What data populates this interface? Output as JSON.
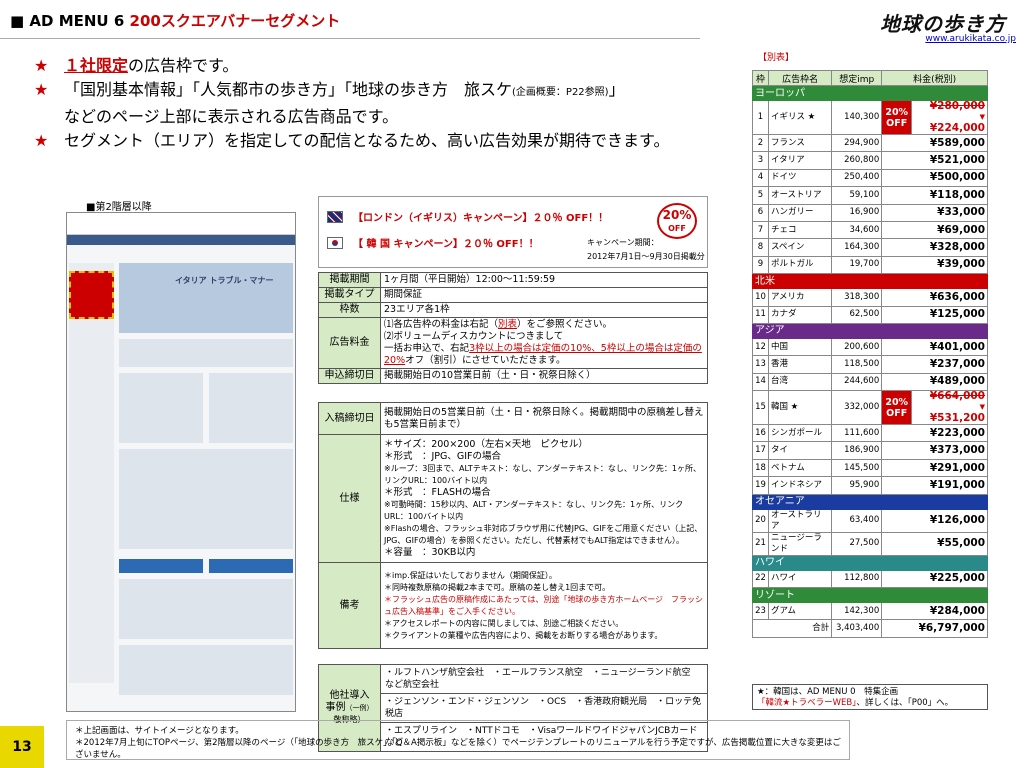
{
  "header": {
    "marker": "■",
    "menu_title": "AD MENU 6",
    "menu_subtitle": "200スクエアバナーセグメント",
    "logo_text": "地球の歩き方",
    "site_url": "www.arukikata.co.jp"
  },
  "bullets": {
    "star": "★",
    "line1_red": "１社限定",
    "line1_rest": "の広告枠です。",
    "line2_a": "「国別基本情報」「人気都市の歩き方」「地球の歩き方　旅スケ",
    "line2_ref": "(企画概要：P22参照)",
    "line2_b": "」",
    "line2_c": "などのページ上部に表示される広告商品です。",
    "line3": "セグメント（エリア）を指定しての配信となるため、高い広告効果が期待できます。"
  },
  "mockup": {
    "caption": "■第2階層以降",
    "hero_text": "イタリア トラブル・マナー"
  },
  "campaign": {
    "uk": "【ロンドン（イギリス）キャンペーン】２０％ OFF！！",
    "kr": "【 韓 国 キャンペーン】２０％ OFF！！",
    "period_label": "キャンペーン期間：",
    "period_value": "2012年7月1日～9月30日掲載分",
    "badge_pct": "20%",
    "badge_off": "OFF"
  },
  "spec": {
    "period_label": "掲載期間",
    "period_value": "1ヶ月間（平日開始）12:00～11:59:59",
    "type_label": "掲載タイプ",
    "type_value": "期間保証",
    "slots_label": "枠数",
    "slots_value": "23エリア各1枠",
    "fee_label": "広告料金",
    "fee_1a": "⑴各広告枠の料金は右記（",
    "fee_1b": "別表",
    "fee_1c": "）をご参照ください。",
    "fee_2": "⑵ボリュームディスカウントにつきまして",
    "fee_3a": "一括お申込で、右記",
    "fee_3b": "3枠以上の場合は定価の10%、5枠以上の場合は定価の20%",
    "fee_3c": "オフ（割引）にさせていただきます。",
    "deadline_label": "申込締切日",
    "deadline_value": "掲載開始日の10営業日前（土・日・祝祭日除く）",
    "submit_label": "入稿締切日",
    "submit_value": "掲載開始日の5営業日前（土・日・祝祭日除く。掲載期間中の原稿差し替えも5営業日前まで）",
    "spec_label": "仕様",
    "spec_size": "＊サイズ：200×200（左右×天地　ピクセル）",
    "spec_jpg": "＊形式　：JPG、GIFの場合",
    "spec_jpg_note": "※ループ：3回まで、ALTテキスト：なし、アンダーテキスト：なし、リンク先：1ヶ所、リンクURL：100バイト以内",
    "spec_flash": "＊形式　：FLASHの場合",
    "spec_flash_note": "※可動時間：15秒以内、ALT・アンダーテキスト：なし、リンク先：1ヶ所、リンクURL：100バイト以内",
    "spec_flash_note2": "※Flashの場合、フラッシュ非対応ブラウザ用に代替JPG、GIFをご用意ください（上記、JPG、GIFの場合）を参照ください。ただし、代替素材でもALT指定はできません）。",
    "spec_cap": "＊容量　：30KB以内",
    "remarks_label": "備考",
    "rem1": "＊imp.保証はいたしておりません（期間保証）。",
    "rem2": "＊同時複数原稿の掲載2本まで可。原稿の差し替え1回まで可。",
    "rem3": "＊フラッシュ広告の原稿作成にあたっては、別途「地球の歩き方ホームページ　フラッシュ広告入稿基準」をご入手ください。",
    "rem4": "＊アクセスレポートの内容に関しましては、別途ご相談ください。",
    "rem5": "＊クライアントの業種や広告内容により、掲載をお断りする場合があります。"
  },
  "partners": {
    "label1": "他社導入",
    "label2": "事例",
    "label2b": "（一例）",
    "label3": "敬称略）",
    "row1": "・ルフトハンザ航空会社　・エールフランス航空　・ニュージーランド航空　など航空会社",
    "row2": "・ジェンソン・エンド・ジェンソン　・OCS　・香港政府観光局　・ロッテ免税店",
    "row3": "・エスプリライン　・NTTドコモ　・VisaワールドワイドジャパンJCBカード　など"
  },
  "price_table": {
    "caption": "【別表】",
    "headers": [
      "枠",
      "広告枠名",
      "想定imp",
      "料金(税別)"
    ],
    "regions": {
      "europe": "ヨーロッパ",
      "na": "北米",
      "asia": "アジア",
      "oceania": "オセアニア",
      "hawaii": "ハワイ",
      "resort": "リゾート"
    },
    "disc_label": "20%",
    "disc_off": "OFF",
    "rows": [
      {
        "no": "1",
        "name": "イギリス ★",
        "imp": "140,300",
        "was": "¥280,000",
        "arrow": "▼",
        "price": "¥224,000"
      },
      {
        "no": "2",
        "name": "フランス",
        "imp": "294,900",
        "price": "¥589,000"
      },
      {
        "no": "3",
        "name": "イタリア",
        "imp": "260,800",
        "price": "¥521,000"
      },
      {
        "no": "4",
        "name": "ドイツ",
        "imp": "250,400",
        "price": "¥500,000"
      },
      {
        "no": "5",
        "name": "オーストリア",
        "imp": "59,100",
        "price": "¥118,000"
      },
      {
        "no": "6",
        "name": "ハンガリー",
        "imp": "16,900",
        "price": "¥33,000"
      },
      {
        "no": "7",
        "name": "チェコ",
        "imp": "34,600",
        "price": "¥69,000"
      },
      {
        "no": "8",
        "name": "スペイン",
        "imp": "164,300",
        "price": "¥328,000"
      },
      {
        "no": "9",
        "name": "ポルトガル",
        "imp": "19,700",
        "price": "¥39,000"
      },
      {
        "no": "10",
        "name": "アメリカ",
        "imp": "318,300",
        "price": "¥636,000"
      },
      {
        "no": "11",
        "name": "カナダ",
        "imp": "62,500",
        "price": "¥125,000"
      },
      {
        "no": "12",
        "name": "中国",
        "imp": "200,600",
        "price": "¥401,000"
      },
      {
        "no": "13",
        "name": "香港",
        "imp": "118,500",
        "price": "¥237,000"
      },
      {
        "no": "14",
        "name": "台湾",
        "imp": "244,600",
        "price": "¥489,000"
      },
      {
        "no": "15",
        "name": "韓国 ★",
        "imp": "332,000",
        "was": "¥664,000",
        "arrow": "▼",
        "price": "¥531,200"
      },
      {
        "no": "16",
        "name": "シンガポール",
        "imp": "111,600",
        "price": "¥223,000"
      },
      {
        "no": "17",
        "name": "タイ",
        "imp": "186,900",
        "price": "¥373,000"
      },
      {
        "no": "18",
        "name": "ベトナム",
        "imp": "145,500",
        "price": "¥291,000"
      },
      {
        "no": "19",
        "name": "インドネシア",
        "imp": "95,900",
        "price": "¥191,000"
      },
      {
        "no": "20",
        "name": "オーストラリア",
        "imp": "63,400",
        "price": "¥126,000"
      },
      {
        "no": "21",
        "name": "ニュージーランド",
        "imp": "27,500",
        "price": "¥55,000"
      },
      {
        "no": "22",
        "name": "ハワイ",
        "imp": "112,800",
        "price": "¥225,000"
      },
      {
        "no": "23",
        "name": "グアム",
        "imp": "142,300",
        "price": "¥284,000"
      }
    ],
    "total_label": "合計",
    "total_imp": "3,403,400",
    "total_price": "¥6,797,000"
  },
  "note": {
    "line1": "★：韓国は、AD MENU 0　特集企画",
    "line2a": "「韓流★トラベラーWEB」",
    "line2b": "、詳しくは、「P00」へ。"
  },
  "footer": {
    "line1": "＊上記画面は、サイトイメージとなります。",
    "line2": "＊2012年7月上旬にTOPページ、第2階層以降のページ（「地球の歩き方　旅スケ」「Q＆A掲示板」などを除く）でページテンプレートのリニューアルを行う予定ですが、広告掲載位置に大きな変更はございません。"
  },
  "page_number": "13"
}
